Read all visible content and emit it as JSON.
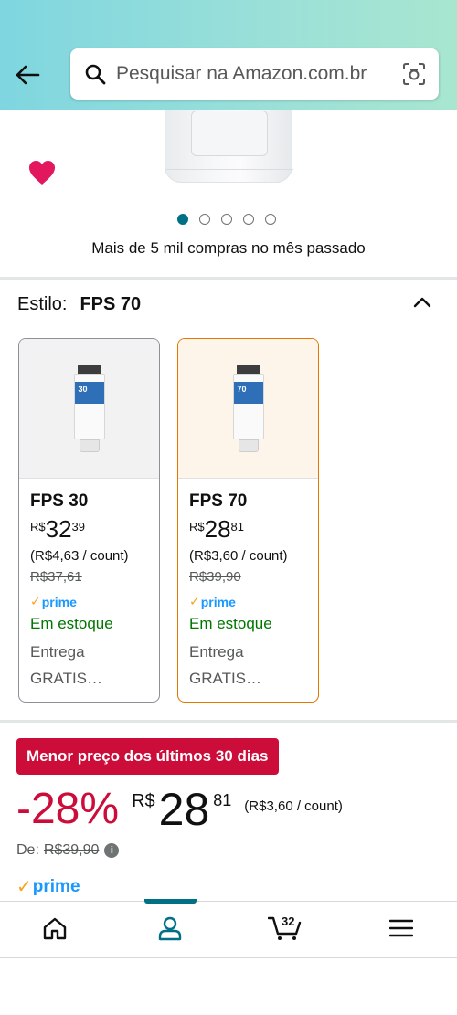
{
  "header": {
    "search_placeholder": "Pesquisar na Amazon.com.br"
  },
  "gallery": {
    "dot_count": 5,
    "active_index": 0,
    "purchases_text": "Mais de 5 mil compras no mês passado"
  },
  "style_selector": {
    "label": "Estilo:",
    "selected_value": "FPS 70",
    "options": [
      {
        "title": "FPS 30",
        "tube_label": "30",
        "currency": "R$",
        "price_whole": "32",
        "price_fraction": "39",
        "unit_price": "(R$4,63 / count)",
        "list_price": "R$37,61",
        "prime": "prime",
        "availability": "Em estoque",
        "delivery_line1": "Entrega",
        "delivery_line2": "GRATIS…",
        "selected": false
      },
      {
        "title": "FPS 70",
        "tube_label": "70",
        "currency": "R$",
        "price_whole": "28",
        "price_fraction": "81",
        "unit_price": "(R$3,60 / count)",
        "list_price": "R$39,90",
        "prime": "prime",
        "availability": "Em estoque",
        "delivery_line1": "Entrega",
        "delivery_line2": "GRATIS…",
        "selected": true
      }
    ]
  },
  "deal": {
    "badge": "Menor preço dos últimos 30 dias",
    "discount": "-28%",
    "currency": "R$",
    "price_whole": "28",
    "price_fraction": "81",
    "unit_price": "(R$3,60 / count)",
    "de_label": "De:",
    "list_price": "R$39,90",
    "prime": "prime"
  },
  "bottom_nav": {
    "cart_count": "32",
    "active": "account"
  },
  "colors": {
    "accent": "#007185",
    "deal_red": "#cc0c39",
    "in_stock_green": "#007600",
    "prime_blue": "#1a98ff",
    "selected_border": "#e77600"
  }
}
